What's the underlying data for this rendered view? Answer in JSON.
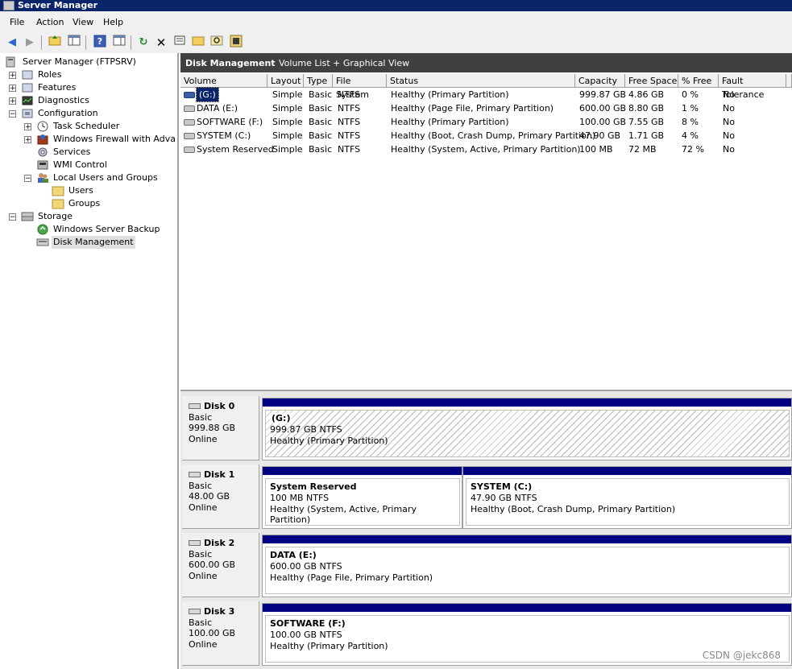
{
  "window": {
    "title": "Server Manager"
  },
  "menu": [
    "File",
    "Action",
    "View",
    "Help"
  ],
  "toolbar": {
    "icons": [
      "back-arrow-icon",
      "forward-arrow-icon",
      "up-folder-icon",
      "show-hide-tree-icon",
      "help-icon",
      "properties-view-icon",
      "refresh-icon",
      "delete-icon",
      "properties-icon",
      "open-folder-icon",
      "find-icon",
      "disk-icon"
    ]
  },
  "tree": {
    "root": "Server Manager (FTPSRV)",
    "roles": "Roles",
    "features": "Features",
    "diagnostics": "Diagnostics",
    "configuration": "Configuration",
    "task_scheduler": "Task Scheduler",
    "firewall": "Windows Firewall with Advanced",
    "services": "Services",
    "wmi": "WMI Control",
    "local_users": "Local Users and Groups",
    "users": "Users",
    "groups": "Groups",
    "storage": "Storage",
    "backup": "Windows Server Backup",
    "disk_management": "Disk Management"
  },
  "header": {
    "title": "Disk Management",
    "view": "Volume List + Graphical View"
  },
  "volume_list": {
    "columns": [
      "Volume",
      "Layout",
      "Type",
      "File System",
      "Status",
      "Capacity",
      "Free Space",
      "% Free",
      "Fault Tolerance"
    ],
    "rows": [
      {
        "volume": "(G:)",
        "layout": "Simple",
        "type": "Basic",
        "fs": "NTFS",
        "status": "Healthy (Primary Partition)",
        "capacity": "999.87 GB",
        "free": "4.86 GB",
        "pct": "0 %",
        "ft": "No"
      },
      {
        "volume": "DATA (E:)",
        "layout": "Simple",
        "type": "Basic",
        "fs": "NTFS",
        "status": "Healthy (Page File, Primary Partition)",
        "capacity": "600.00 GB",
        "free": "8.80 GB",
        "pct": "1 %",
        "ft": "No"
      },
      {
        "volume": "SOFTWARE (F:)",
        "layout": "Simple",
        "type": "Basic",
        "fs": "NTFS",
        "status": "Healthy (Primary Partition)",
        "capacity": "100.00 GB",
        "free": "7.55 GB",
        "pct": "8 %",
        "ft": "No"
      },
      {
        "volume": "SYSTEM (C:)",
        "layout": "Simple",
        "type": "Basic",
        "fs": "NTFS",
        "status": "Healthy (Boot, Crash Dump, Primary Partition)",
        "capacity": "47.90 GB",
        "free": "1.71 GB",
        "pct": "4 %",
        "ft": "No"
      },
      {
        "volume": "System Reserved",
        "layout": "Simple",
        "type": "Basic",
        "fs": "NTFS",
        "status": "Healthy (System, Active, Primary Partition)",
        "capacity": "100 MB",
        "free": "72 MB",
        "pct": "72 %",
        "ft": "No"
      }
    ]
  },
  "disks": [
    {
      "name": "Disk 0",
      "type": "Basic",
      "size": "999.88 GB",
      "state": "Online",
      "partitions": [
        {
          "title": "(G:)",
          "size": "999.87 GB NTFS",
          "status": "Healthy (Primary Partition)"
        }
      ]
    },
    {
      "name": "Disk 1",
      "type": "Basic",
      "size": "48.00 GB",
      "state": "Online",
      "partitions": [
        {
          "title": "System Reserved",
          "size": "100 MB NTFS",
          "status": "Healthy (System, Active, Primary Partition)"
        },
        {
          "title": "SYSTEM  (C:)",
          "size": "47.90 GB NTFS",
          "status": "Healthy (Boot, Crash Dump, Primary Partition)"
        }
      ]
    },
    {
      "name": "Disk 2",
      "type": "Basic",
      "size": "600.00 GB",
      "state": "Online",
      "partitions": [
        {
          "title": "DATA  (E:)",
          "size": "600.00 GB NTFS",
          "status": "Healthy (Page File, Primary Partition)"
        }
      ]
    },
    {
      "name": "Disk 3",
      "type": "Basic",
      "size": "100.00 GB",
      "state": "Online",
      "partitions": [
        {
          "title": "SOFTWARE  (F:)",
          "size": "100.00 GB NTFS",
          "status": "Healthy (Primary Partition)"
        }
      ]
    }
  ],
  "watermark": "CSDN @jekc868",
  "colors": {
    "titlebar": "#0a246a",
    "partition_bar": "#000080",
    "header": "#404040"
  }
}
